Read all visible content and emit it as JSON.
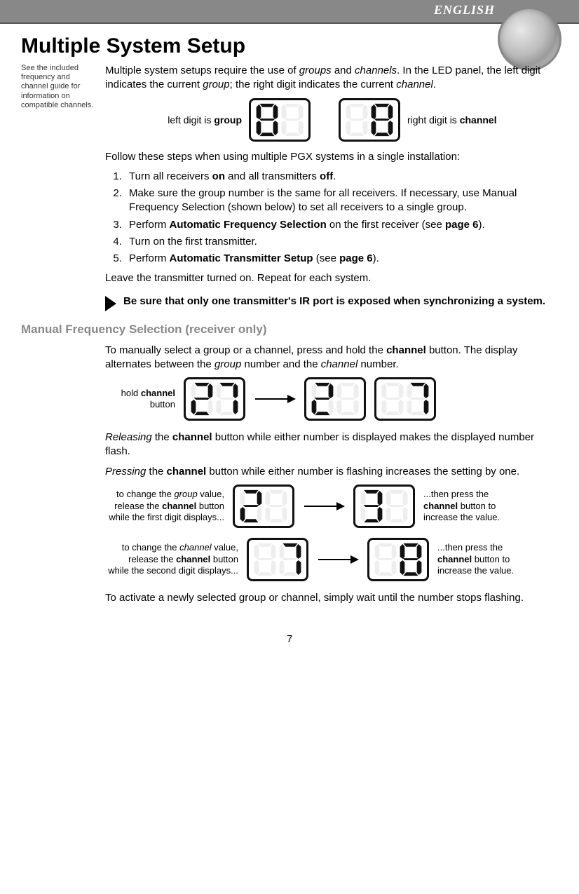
{
  "lang": "ENGLISH",
  "title": "Multiple System Setup",
  "sidenote": "See the included frequency and channel guide for information on compatible channels.",
  "intro_parts": {
    "a": "Multiple system setups require the use of ",
    "b_it": "groups",
    "c": " and ",
    "d_it": "channels",
    "e": ". In the LED panel, the left digit indicates the current ",
    "f_it": "group",
    "g": "; the right digit indi­cates the current ",
    "h_it": "channel",
    "i": "."
  },
  "left_digit_label_pre": "left digit is ",
  "left_digit_label_bold": "group",
  "right_digit_label_pre": "right digit is ",
  "right_digit_label_bold": "channel",
  "follow": "Follow these steps when using multiple PGX systems in a single installation:",
  "steps": {
    "s1a": "Turn all receivers ",
    "s1b": "on",
    "s1c": " and all transmitters ",
    "s1d": "off",
    "s1e": ".",
    "s2": "Make sure the group number is the same for all receivers. If nec­essary, use Manual Frequency Selection (shown below) to set all receivers to a single group.",
    "s3a": "Perform ",
    "s3b": "Automatic Frequency Selection",
    "s3c": " on the first receiver (see ",
    "s3d": "page 6",
    "s3e": ").",
    "s4": "Turn on the first transmitter.",
    "s5a": "Perform ",
    "s5b": "Automatic Transmitter Setup",
    "s5c": " (see ",
    "s5d": "page 6",
    "s5e": ")."
  },
  "leave": "Leave the transmitter turned on. Repeat for each system.",
  "warn": "Be sure that only one transmitter's IR port is exposed when synchronizing a system.",
  "sub": "Manual Frequency Selection (receiver only)",
  "manual_intro": {
    "a": "To manually select a group or a channel, press and hold the ",
    "b": "channel",
    "c": " button. The display alternates between the ",
    "d_it": "group",
    "e": " number and the ",
    "f_it": "channel",
    "g": " number."
  },
  "hold_pre": "hold ",
  "hold_bold": "channel",
  "hold_post": " button",
  "release": {
    "a_it": "Releasing",
    "b": " the ",
    "c_b": "channel",
    "d": " button while either number is displayed makes the displayed number flash."
  },
  "press": {
    "a_it": "Pressing",
    "b": " the ",
    "c_b": "channel",
    "d": " button while either number is flashing increases the setting by one."
  },
  "group_change": {
    "l_a": "to change the ",
    "l_b_it": "group",
    "l_c": " value, release the ",
    "l_d_b": "channel",
    "l_e": " button while the first digit displays...",
    "r_a": "...then press the ",
    "r_b_b": "channel",
    "r_c": " button to increase the value."
  },
  "chan_change": {
    "l_a": "to change the ",
    "l_b_it": "channel",
    "l_c": " value, release the ",
    "l_d_b": "channel",
    "l_e": " button while the second digit displays...",
    "r_a": "...then press the ",
    "r_b_b": "channel",
    "r_c": " button to increase the value."
  },
  "activate": "To activate a newly selected group or channel, simply wait until the number stops flashing.",
  "page_number": "7"
}
